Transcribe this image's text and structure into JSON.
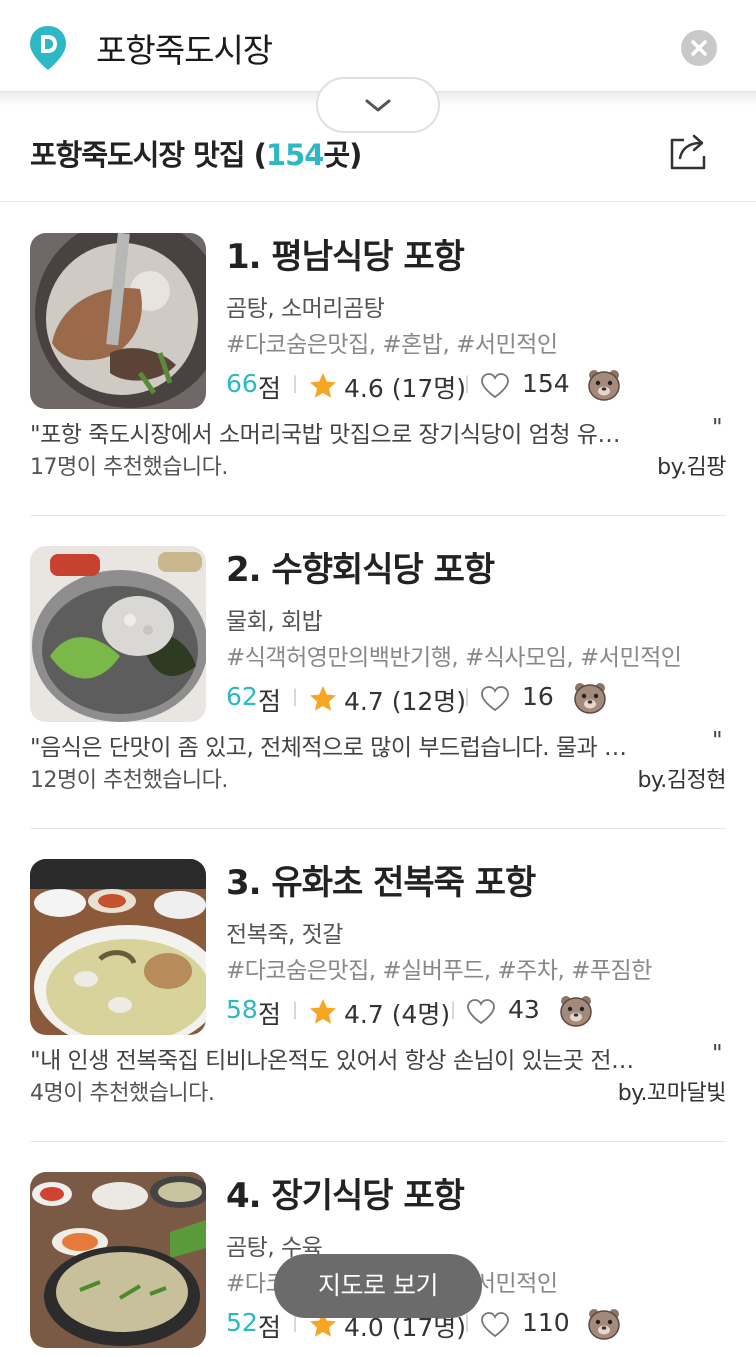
{
  "header": {
    "search_query": "포항죽도시장",
    "colors": {
      "accent": "#2cb8c4",
      "clear_button": "#c9c9c9"
    }
  },
  "title": {
    "prefix": "포항죽도시장 맛집 (",
    "count": "154",
    "suffix": "곳)"
  },
  "restaurants": [
    {
      "rank_name": "1. 평남식당 포항",
      "category": "곰탕, 소머리곰탕",
      "tags": "#다코숨은맛집, #혼밥, #서민적인",
      "score": "66",
      "score_unit": "점",
      "rating": "4.6 (17명)",
      "likes": "154",
      "quote": "\"포항 죽도시장에서 소머리국밥 맛집으로 장기식당이 엄청 유…",
      "quote_close": "\"",
      "recommend": "17명이 추천했습니다.",
      "by": "by.김팡"
    },
    {
      "rank_name": "2. 수향회식당 포항",
      "category": "물회, 회밥",
      "tags": "#식객허영만의백반기행, #식사모임, #서민적인",
      "score": "62",
      "score_unit": "점",
      "rating": "4.7 (12명)",
      "likes": "16",
      "quote": "\"음식은 단맛이 좀 있고, 전체적으로 많이 부드럽습니다. 물과 …",
      "quote_close": "\"",
      "recommend": "12명이 추천했습니다.",
      "by": "by.김정현"
    },
    {
      "rank_name": "3. 유화초 전복죽 포항",
      "category": "전복죽, 젓갈",
      "tags": "#다코숨은맛집, #실버푸드, #주차, #푸짐한",
      "score": "58",
      "score_unit": "점",
      "rating": "4.7 (4명)",
      "likes": "43",
      "quote": "\"내 인생 전복죽집 티비나온적도 있어서 항상 손님이 있는곳 전…",
      "quote_close": "\"",
      "recommend": "4명이 추천했습니다.",
      "by": "by.꼬마달빛"
    },
    {
      "rank_name": "4. 장기식당 포항",
      "category": "곰탕, 수육",
      "tags": "#다코숨은맛집, #혼밥, #서민적인",
      "score": "52",
      "score_unit": "점",
      "rating": "4.0 (17명)",
      "likes": "110"
    }
  ],
  "map_button": {
    "label": "지도로 보기"
  },
  "icons": {
    "logo": "diningcode-logo-icon",
    "clear": "close-icon",
    "collapse": "chevron-down-icon",
    "share": "share-icon",
    "star": "star-icon",
    "heart": "heart-icon",
    "bear": "bear-face-icon"
  }
}
